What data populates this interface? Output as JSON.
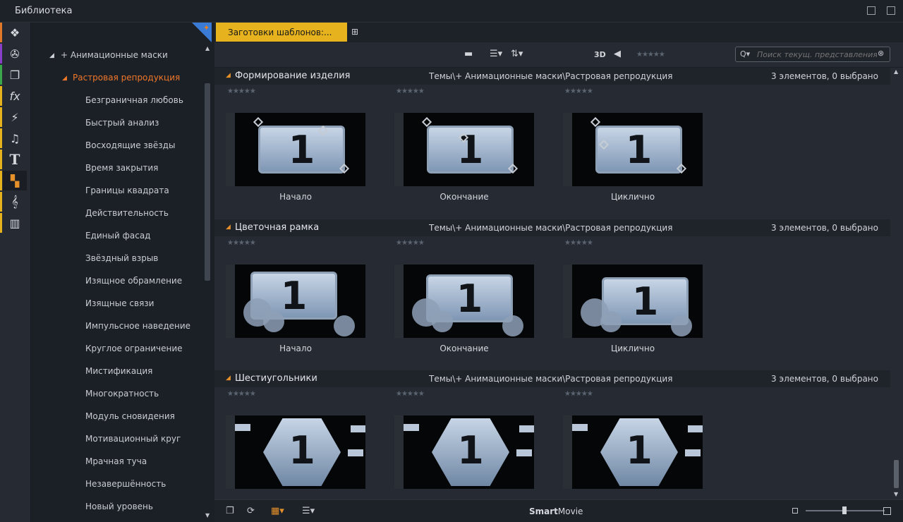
{
  "window": {
    "title": "Библиотека"
  },
  "iconbar": [
    {
      "icon": "box-icon",
      "glyph": "❖",
      "color": "#e0782a"
    },
    {
      "icon": "film-reel-icon",
      "glyph": "✇",
      "color": "#8a3fc9"
    },
    {
      "icon": "photo-stack-icon",
      "glyph": "❐",
      "color": "#3aa84a"
    },
    {
      "icon": "fx-icon",
      "glyph": "fx",
      "color": "#e6b31e"
    },
    {
      "icon": "lightning-icon",
      "glyph": "⚡",
      "color": "#e6b31e"
    },
    {
      "icon": "music-note-icon",
      "glyph": "♫",
      "color": "#e6b31e"
    },
    {
      "icon": "title-text-icon",
      "glyph": "T",
      "color": "#e6b31e"
    },
    {
      "icon": "montage-icon",
      "glyph": "▚",
      "color": "#e6b31e"
    },
    {
      "icon": "treble-clef-icon",
      "glyph": "𝄞",
      "color": "#e6b31e"
    },
    {
      "icon": "piano-keys-icon",
      "glyph": "▥",
      "color": "#e6b31e"
    }
  ],
  "tree": {
    "parent": "+ Анимационные маски",
    "selected": "Растровая репродукция",
    "items": [
      "Безграничная любовь",
      "Быстрый анализ",
      "Восходящие звёзды",
      "Время закрытия",
      "Границы квадрата",
      "Действительность",
      "Единый фасад",
      "Звёздный взрыв",
      "Изящное обрамление",
      "Изящные связи",
      "Импульсное наведение",
      "Круглое ограничение",
      "Мистификация",
      "Многократность",
      "Модуль сновидения",
      "Мотивационный круг",
      "Мрачная туча",
      "Незавершённость",
      "Новый уровень"
    ]
  },
  "tabs": {
    "active": "Заготовки шаблонов:..."
  },
  "toolbar": {
    "view_3d": "3D",
    "search_placeholder": "Поиск текущ. представления"
  },
  "groups": [
    {
      "name": "Формирование изделия",
      "path": "Темы\\+ Анимационные маски\\Растровая репродукция",
      "count": "3 элементов, 0 выбрано",
      "style": "frame",
      "items": [
        {
          "label": "Начало"
        },
        {
          "label": "Окончание"
        },
        {
          "label": "Циклично"
        }
      ]
    },
    {
      "name": "Цветочная рамка",
      "path": "Темы\\+ Анимационные маски\\Растровая репродукция",
      "count": "3 элементов, 0 выбрано",
      "style": "flower",
      "items": [
        {
          "label": "Начало"
        },
        {
          "label": "Окончание"
        },
        {
          "label": "Циклично"
        }
      ]
    },
    {
      "name": "Шестиугольники",
      "path": "Темы\\+ Анимационные маски\\Растровая репродукция",
      "count": "3 элементов, 0 выбрано",
      "style": "hex",
      "items": [
        {
          "label": "",
          "digit": "1"
        },
        {
          "label": "",
          "digit": "1"
        },
        {
          "label": "",
          "digit": "1"
        }
      ]
    }
  ],
  "thumb_digit": "1",
  "bottombar": {
    "brand_bold": "Smart",
    "brand_rest": "Movie"
  }
}
